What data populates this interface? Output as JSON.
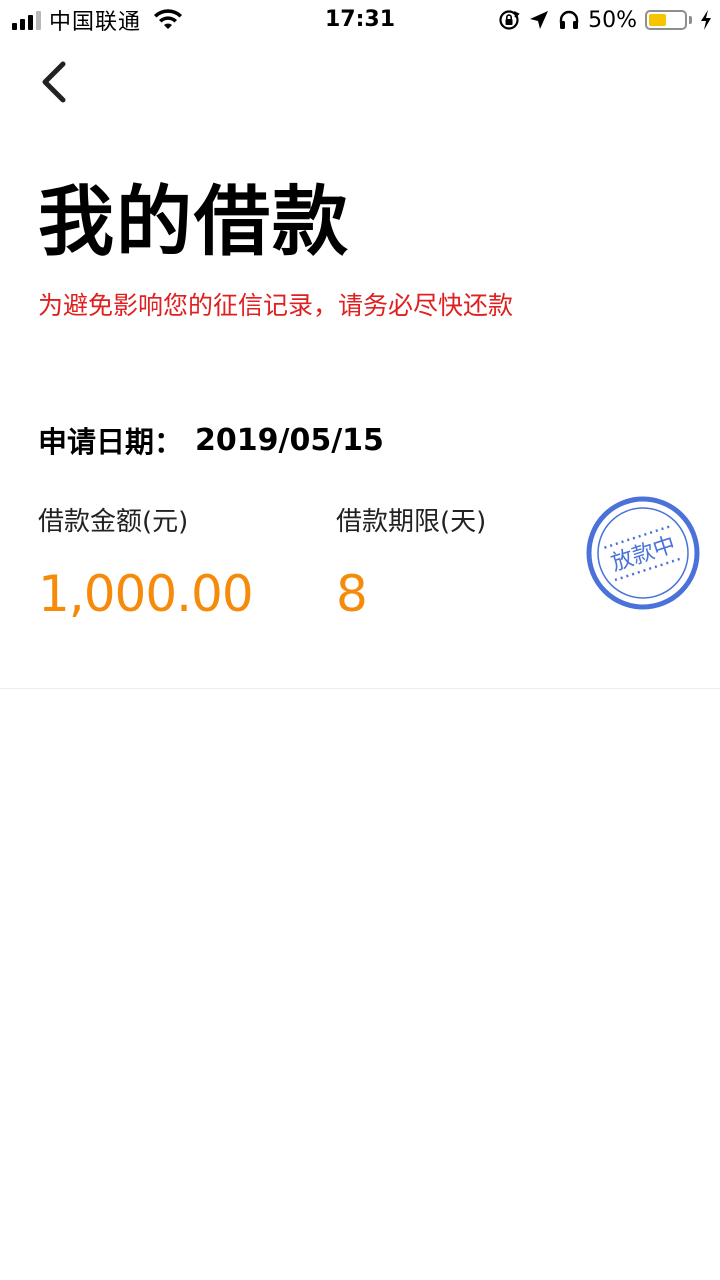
{
  "status_bar": {
    "carrier": "中国联通",
    "time": "17:31",
    "battery_percent": "50%",
    "battery_level": 0.5,
    "icons": [
      "signal-icon",
      "wifi-icon",
      "rotation-lock-icon",
      "location-icon",
      "headphones-icon",
      "battery-icon",
      "charging-icon"
    ]
  },
  "header": {
    "back_icon": "chevron-left-icon",
    "title": "我的借款"
  },
  "notice": "为避免影响您的征信记录，请务必尽快还款",
  "apply": {
    "label": "申请日期：",
    "date": "2019/05/15"
  },
  "loan": {
    "amount_label": "借款金额(元)",
    "amount_value": "1,000.00",
    "term_label": "借款期限(天)",
    "term_value": "8"
  },
  "stamp": {
    "text": "放款中",
    "color": "#4a72d9"
  },
  "colors": {
    "notice": "#e02020",
    "value": "#f58a0b",
    "stamp": "#4a72d9",
    "battery": "#f7c500"
  }
}
